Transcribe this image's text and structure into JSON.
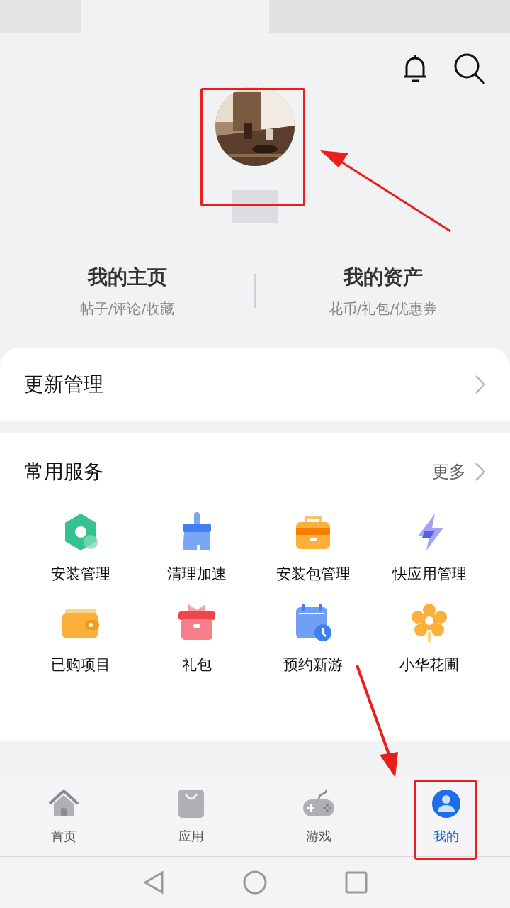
{
  "stats": [
    {
      "title": "我的主页",
      "subtitle": "帖子/评论/收藏"
    },
    {
      "title": "我的资产",
      "subtitle": "花币/礼包/优惠券"
    }
  ],
  "update_row": {
    "label": "更新管理"
  },
  "services": {
    "title": "常用服务",
    "more": "更多",
    "items": [
      {
        "label": "安装管理",
        "kind": "hexagon"
      },
      {
        "label": "清理加速",
        "kind": "brush"
      },
      {
        "label": "安装包管理",
        "kind": "briefcase"
      },
      {
        "label": "快应用管理",
        "kind": "bolt"
      },
      {
        "label": "已购项目",
        "kind": "wallet"
      },
      {
        "label": "礼包",
        "kind": "gift"
      },
      {
        "label": "预约新游",
        "kind": "calendar"
      },
      {
        "label": "小华花圃",
        "kind": "flower"
      }
    ]
  },
  "tabs": [
    {
      "label": "首页",
      "kind": "home",
      "selected": false
    },
    {
      "label": "应用",
      "kind": "bag",
      "selected": false
    },
    {
      "label": "游戏",
      "kind": "gamepad",
      "selected": false
    },
    {
      "label": "我的",
      "kind": "person",
      "selected": true
    }
  ]
}
